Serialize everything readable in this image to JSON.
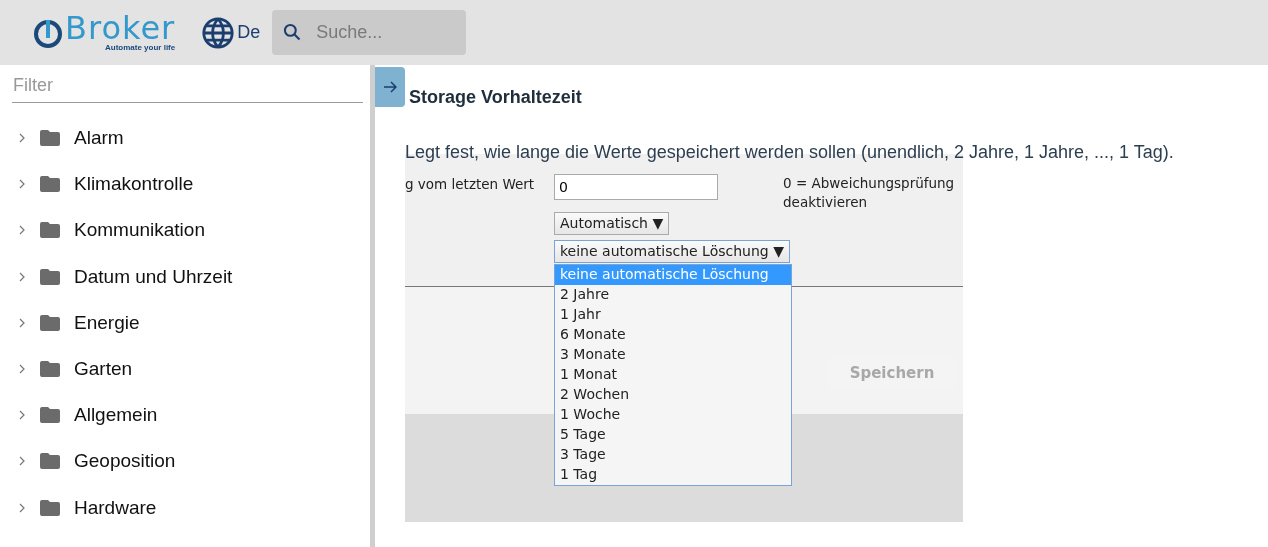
{
  "header": {
    "logo": {
      "name": "Broker",
      "tagline": "Automate your life"
    },
    "language": "De",
    "search": {
      "placeholder": "Suche..."
    }
  },
  "sidebar": {
    "filter": {
      "placeholder": "Filter"
    },
    "items": [
      {
        "label": "Alarm",
        "expanded": false
      },
      {
        "label": "Klimakontrolle",
        "expanded": false
      },
      {
        "label": "Kommunikation",
        "expanded": false
      },
      {
        "label": "Datum und Uhrzeit",
        "expanded": false
      },
      {
        "label": "Energie",
        "expanded": false
      },
      {
        "label": "Garten",
        "expanded": false
      },
      {
        "label": "Allgemein",
        "expanded": false
      },
      {
        "label": "Geoposition",
        "expanded": false
      },
      {
        "label": "Hardware",
        "expanded": false
      }
    ]
  },
  "main": {
    "title": "Storage Vorhaltezeit",
    "description": "Legt fest, wie lange die Werte gespeichert werden sollen (unendlich, 2 Jahre, 1 Jahre, ..., 1 Tag).",
    "screenshot": {
      "field": {
        "label": "g vom letzten Wert",
        "value": "0",
        "note": "0 = Abweichungsprüfung deaktivieren"
      },
      "mode_select": "Automatisch ▼",
      "retention_select": {
        "value": "keine automatische Löschung ▼",
        "open": true,
        "options": [
          {
            "label": "keine automatische Löschung",
            "selected": true
          },
          {
            "label": "2 Jahre",
            "selected": false
          },
          {
            "label": "1 Jahr",
            "selected": false
          },
          {
            "label": "6 Monate",
            "selected": false
          },
          {
            "label": "3 Monate",
            "selected": false
          },
          {
            "label": "1 Monat",
            "selected": false
          },
          {
            "label": "2 Wochen",
            "selected": false
          },
          {
            "label": "1 Woche",
            "selected": false
          },
          {
            "label": "5 Tage",
            "selected": false
          },
          {
            "label": "3 Tage",
            "selected": false
          },
          {
            "label": "1 Tag",
            "selected": false
          }
        ]
      },
      "save_button": {
        "label": "Speichern",
        "disabled": true
      }
    }
  }
}
